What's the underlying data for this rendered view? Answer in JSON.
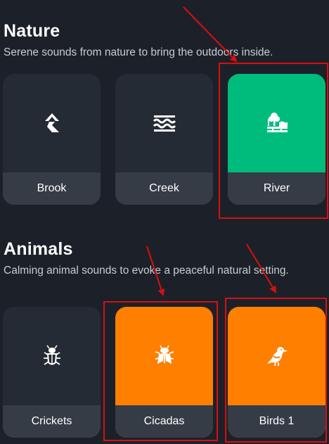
{
  "nature": {
    "title": "Nature",
    "description": "Serene sounds from nature to bring the outdoors inside.",
    "tiles": [
      {
        "label": "Brook",
        "icon": "brook-icon",
        "color": "#252b34"
      },
      {
        "label": "Creek",
        "icon": "creek-waves-icon",
        "color": "#252b34"
      },
      {
        "label": "River",
        "icon": "river-tree-icon",
        "color": "#00bc7c"
      }
    ]
  },
  "animals": {
    "title": "Animals",
    "description": "Calming animal sounds to evoke a peaceful natural setting.",
    "tiles": [
      {
        "label": "Crickets",
        "icon": "cricket-icon",
        "color": "#252b34"
      },
      {
        "label": "Cicadas",
        "icon": "cicada-icon",
        "color": "#ff7f00"
      },
      {
        "label": "Birds 1",
        "icon": "bird-icon",
        "color": "#ff7f00"
      }
    ]
  },
  "colors": {
    "background": "#1c2129",
    "tile": "#252b34",
    "tile_label_bar": "#363c46",
    "teal_accent": "#00bc7c",
    "orange_accent": "#ff7f00",
    "annotation_red": "#d80f0f"
  }
}
